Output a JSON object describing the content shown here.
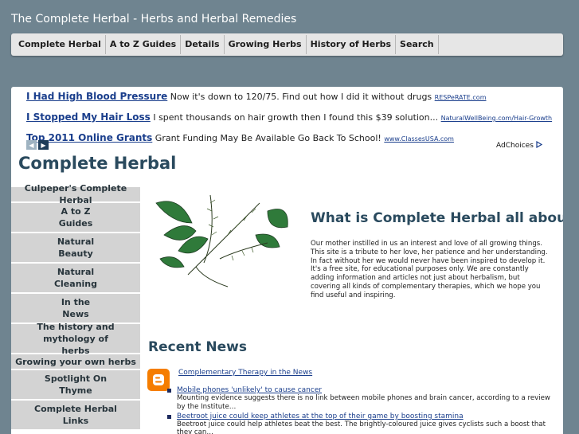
{
  "site_title": "The Complete Herbal - Herbs and Herbal Remedies",
  "nav": [
    {
      "label": "Complete Herbal"
    },
    {
      "label": "A to Z Guides"
    },
    {
      "label": "Details"
    },
    {
      "label": "Growing Herbs"
    },
    {
      "label": "History of Herbs"
    },
    {
      "label": "Search"
    }
  ],
  "ads": [
    {
      "title": "I Had High Blood Pressure",
      "text": "Now it's down to 120/75. Find out how I did it without drugs",
      "url": "RESPeRATE.com"
    },
    {
      "title": "I Stopped My Hair Loss",
      "text": "I spent thousands on hair growth then I found this $39 solution...",
      "url": "NaturalWellBeing.com/Hair-Growth"
    },
    {
      "title": "Top 2011 Online Grants",
      "text": "Grant Funding May Be Available Go Back To School!",
      "url": "www.ClassesUSA.com"
    }
  ],
  "adchoices": "AdChoices",
  "site_heading": "Complete Herbal",
  "sidebar": [
    {
      "label": "Culpeper's Complete Herbal"
    },
    {
      "label": "A to Z\nGuides"
    },
    {
      "label": "Natural\nBeauty"
    },
    {
      "label": "Natural\nCleaning"
    },
    {
      "label": "In the\nNews"
    },
    {
      "label": "The history and mythology of\nherbs"
    },
    {
      "label": "Growing your own herbs"
    },
    {
      "label": "Spotlight On\nThyme"
    },
    {
      "label": "Complete Herbal\nLinks"
    }
  ],
  "main": {
    "heading": "What is Complete Herbal all about?",
    "intro": "Our mother instilled in us an interest and love of all growing things. This site is a tribute to her love, her patience and her understanding. In fact without her we would never have been inspired to develop it. It's a free site, for educational purposes only. We are constantly adding information and articles not just about herbalism, but covering all kinds of complementary therapies, which we hope you find useful and inspiring."
  },
  "recent_news": {
    "heading": "Recent News",
    "feed_title": "Complementary Therapy in the News",
    "items": [
      {
        "title": "Mobile phones 'unlikely' to cause cancer",
        "summary": "Mounting evidence suggests there is no link between mobile phones and brain cancer, according to a review by the Institute…"
      },
      {
        "title": "Beetroot juice could keep athletes at the top of their game by boosting stamina",
        "summary": "Beetroot juice could help athletes beat the best. The brightly-coloured juice gives cyclists such a boost that they can…"
      }
    ]
  },
  "colors": {
    "background": "#6f8490",
    "heading": "#2a4a5e",
    "link": "#1a3e8c",
    "blogger": "#f57d00"
  }
}
